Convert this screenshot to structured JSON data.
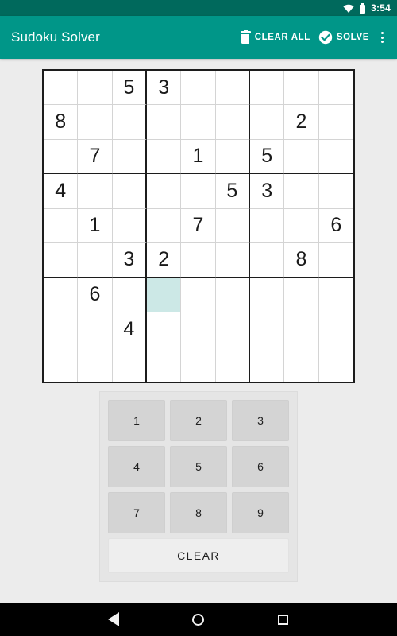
{
  "status_bar": {
    "time": "3:54",
    "wifi_icon": "wifi-icon",
    "battery_icon": "battery-icon",
    "background_color": "#00695c"
  },
  "app_bar": {
    "title": "Sudoku Solver",
    "background_color": "#009688",
    "actions": [
      {
        "id": "clear-all",
        "label": "CLEAR ALL",
        "icon": "trash-icon"
      },
      {
        "id": "solve",
        "label": "SOLVE",
        "icon": "check-circle-icon"
      }
    ],
    "overflow_icon": "more-vertical-icon"
  },
  "board": {
    "rows": 9,
    "cols": 9,
    "selected_cell": {
      "row": 6,
      "col": 3
    },
    "selected_color": "#cce8e6",
    "grid": [
      [
        "",
        "",
        "5",
        "3",
        "",
        "",
        "",
        "",
        ""
      ],
      [
        "8",
        "",
        "",
        "",
        "",
        "",
        "",
        "2",
        ""
      ],
      [
        "",
        "7",
        "",
        "",
        "1",
        "",
        "5",
        "",
        ""
      ],
      [
        "4",
        "",
        "",
        "",
        "",
        "5",
        "3",
        "",
        ""
      ],
      [
        "",
        "1",
        "",
        "",
        "7",
        "",
        "",
        "",
        "6"
      ],
      [
        "",
        "",
        "3",
        "2",
        "",
        "",
        "",
        "8",
        ""
      ],
      [
        "",
        "6",
        "",
        "",
        "",
        "",
        "",
        "",
        ""
      ],
      [
        "",
        "",
        "4",
        "",
        "",
        "",
        "",
        "",
        ""
      ],
      [
        "",
        "",
        "",
        "",
        "",
        "",
        "",
        "",
        ""
      ]
    ]
  },
  "number_pad": {
    "buttons": [
      "1",
      "2",
      "3",
      "4",
      "5",
      "6",
      "7",
      "8",
      "9"
    ],
    "clear_label": "CLEAR"
  },
  "nav_bar": {
    "back_icon": "back-triangle-icon",
    "home_icon": "home-circle-icon",
    "recents_icon": "recents-square-icon"
  }
}
